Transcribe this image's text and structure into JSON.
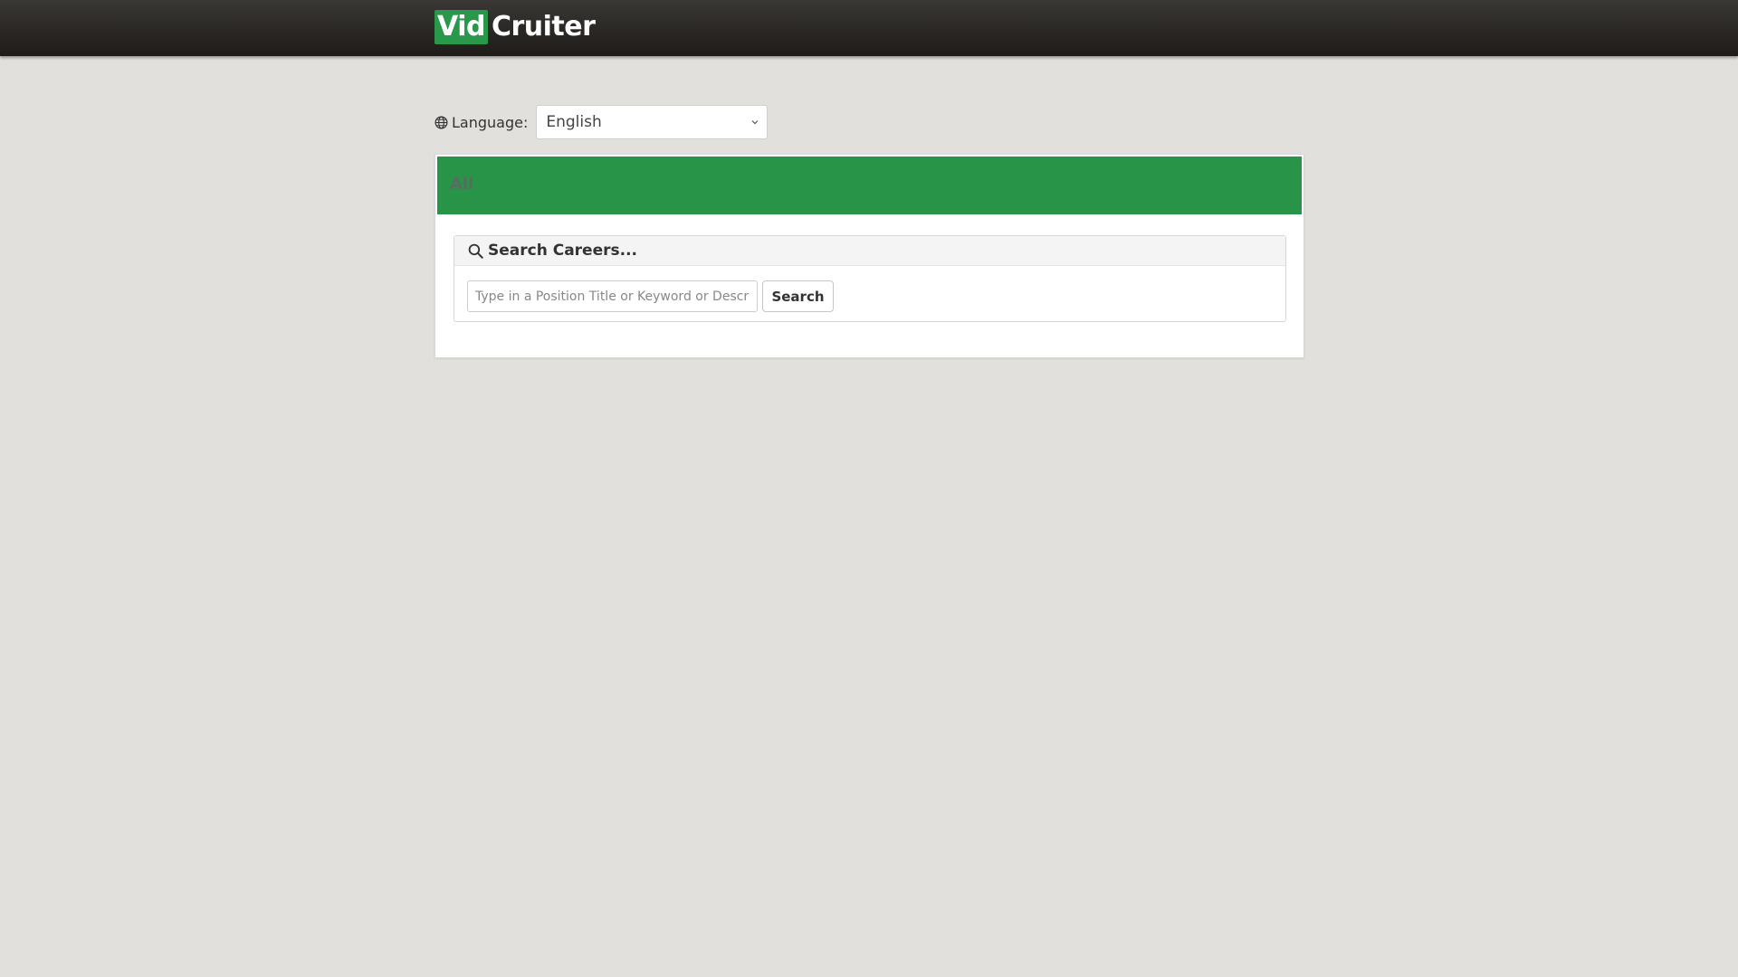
{
  "header": {
    "logo_part1": "Vid",
    "logo_part2": "Cruiter"
  },
  "language": {
    "label": "Language:",
    "selected": "English",
    "icon": "globe-icon"
  },
  "category": {
    "title": "All",
    "color": "#279447"
  },
  "search": {
    "title": "Search Careers...",
    "icon": "search-icon",
    "placeholder": "Type in a Position Title or Keyword or Description",
    "button_label": "Search"
  }
}
